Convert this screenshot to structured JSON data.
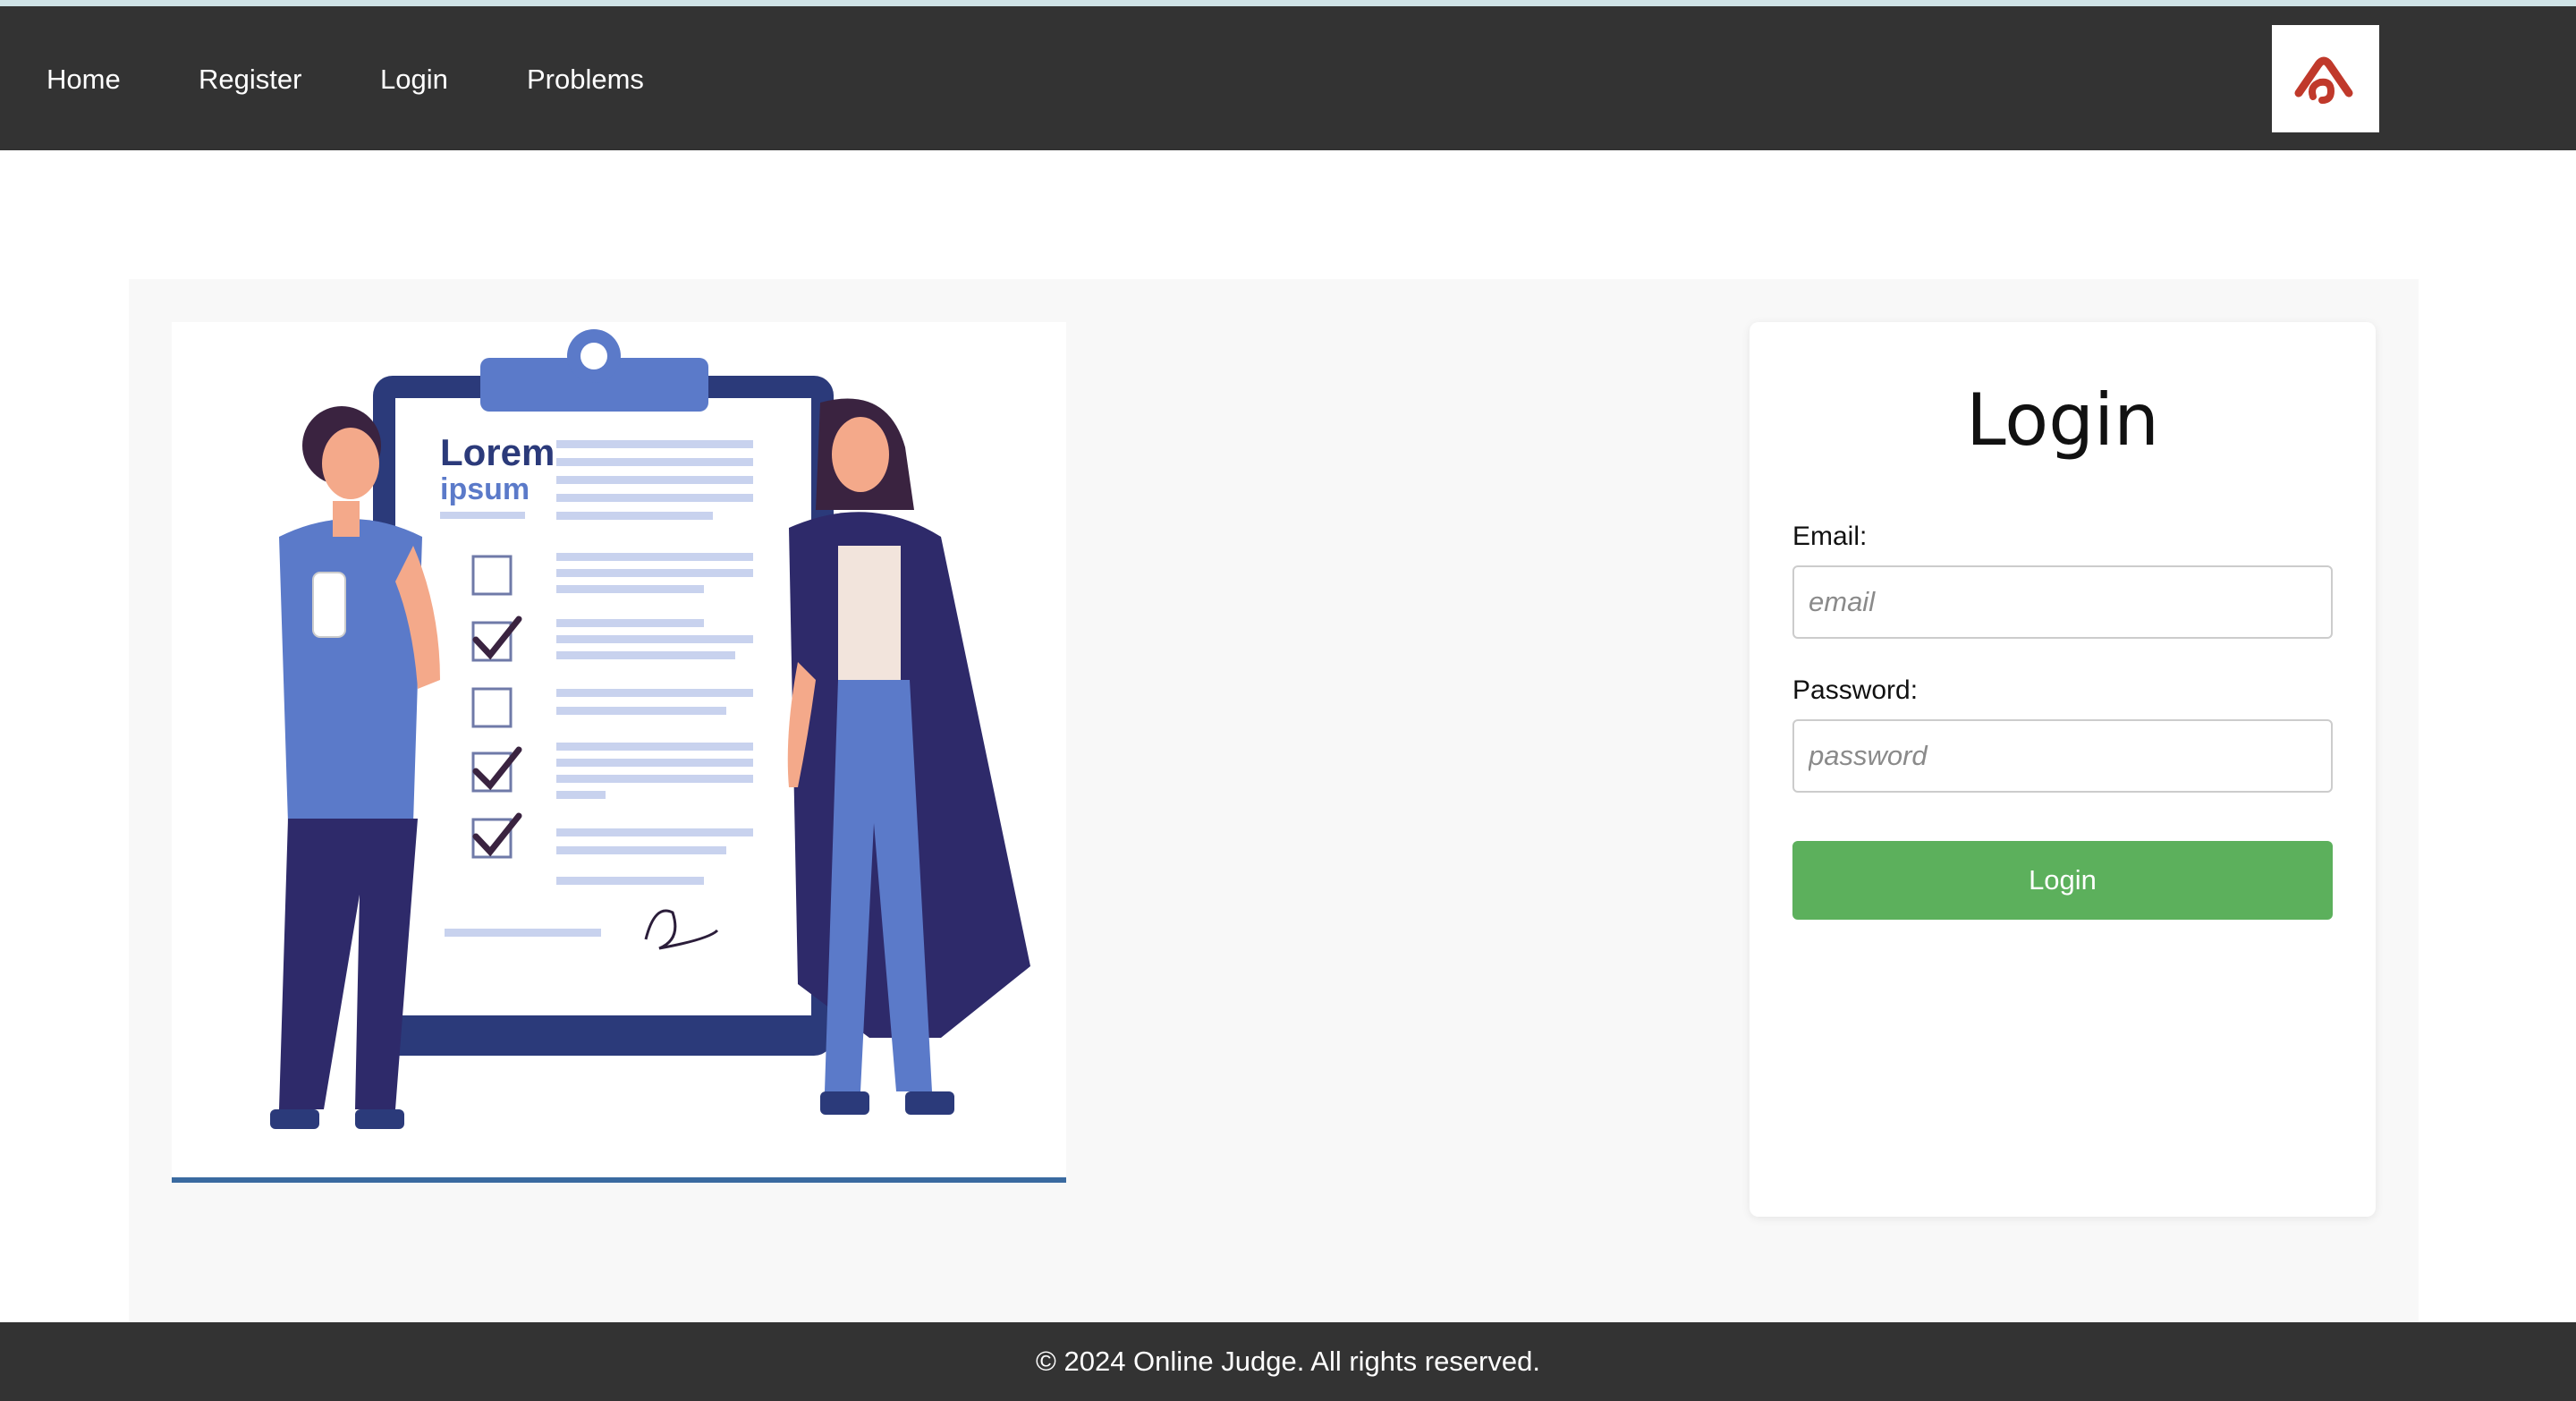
{
  "nav": {
    "links": [
      "Home",
      "Register",
      "Login",
      "Problems"
    ],
    "logo_icon": "codechef-style-logo-icon"
  },
  "illustration": {
    "clipboard_heading": "Lorem",
    "clipboard_subheading": "ipsum",
    "checkbox_states": [
      false,
      true,
      false,
      true,
      true
    ]
  },
  "login_form": {
    "title": "Login",
    "email_label": "Email:",
    "email_placeholder": "email",
    "email_value": "",
    "password_label": "Password:",
    "password_placeholder": "password",
    "password_value": "",
    "submit_label": "Login"
  },
  "footer": {
    "text": "© 2024 Online Judge. All rights reserved."
  },
  "colors": {
    "navbar": "#333333",
    "footer": "#333333",
    "login_button": "#5cb05c",
    "logo_accent": "#c0392b"
  }
}
